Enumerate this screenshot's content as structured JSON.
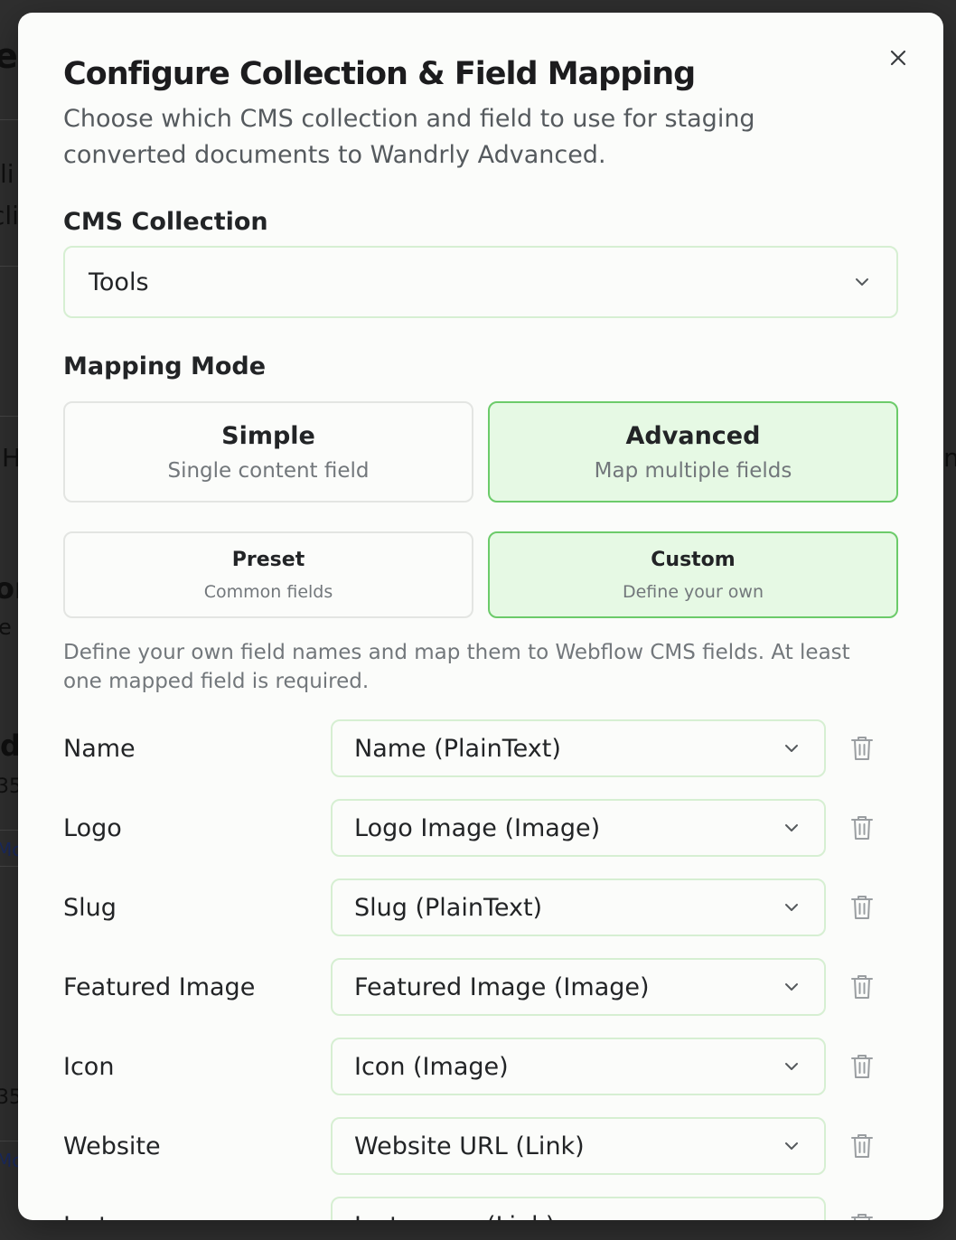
{
  "modal": {
    "title": "Configure Collection & Field Mapping",
    "description": "Choose which CMS collection and field to use for staging converted documents to Wandrly Advanced."
  },
  "collection": {
    "label": "CMS Collection",
    "selected": "Tools"
  },
  "mapping_mode": {
    "label": "Mapping Mode",
    "modes": [
      {
        "label": "Simple",
        "sub": "Single content field",
        "active": false
      },
      {
        "label": "Advanced",
        "sub": "Map multiple fields",
        "active": true
      }
    ],
    "field_sets": [
      {
        "label": "Preset",
        "sub": "Common fields",
        "active": false
      },
      {
        "label": "Custom",
        "sub": "Define your own",
        "active": true
      }
    ],
    "help": "Define your own field names and map them to Webflow CMS fields. At least one mapped field is required."
  },
  "fields": [
    {
      "name": "Name",
      "mapped": "Name (PlainText)"
    },
    {
      "name": "Logo",
      "mapped": "Logo Image (Image)"
    },
    {
      "name": "Slug",
      "mapped": "Slug (PlainText)"
    },
    {
      "name": "Featured Image",
      "mapped": "Featured Image (Image)"
    },
    {
      "name": "Icon",
      "mapped": "Icon (Image)"
    },
    {
      "name": "Website",
      "mapped": "Website URL (Link)"
    },
    {
      "name": "Instagram",
      "mapped": "Instagram (Link)"
    }
  ],
  "background": {
    "fragments": [
      "er",
      "li",
      "cli",
      "H",
      "n",
      "or",
      "e c",
      "d",
      "35",
      "Mc",
      "35",
      "Mc"
    ]
  },
  "colors": {
    "accent_border": "#6ccb6a",
    "accent_fill": "#e6f9e4",
    "input_border": "#d6efd2"
  },
  "icons": {
    "close": "close-icon",
    "chevron": "chevron-down-icon",
    "trash": "trash-icon"
  }
}
